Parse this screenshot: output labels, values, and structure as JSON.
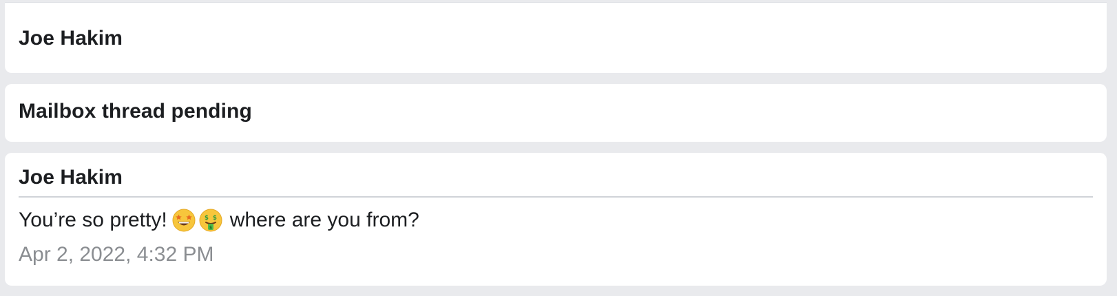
{
  "colors": {
    "background": "#e9eaed",
    "card": "#ffffff",
    "text": "#1c1e21",
    "muted": "#8a8d91",
    "divider": "#d0d3d8"
  },
  "cards": [
    {
      "title": "Joe Hakim"
    },
    {
      "title": "Mailbox thread pending"
    },
    {
      "sender": "Joe Hakim",
      "message_start": "You’re so pretty!",
      "emojis": [
        "star-struck-emoji",
        "money-mouth-emoji"
      ],
      "message_end": "where are you from?",
      "timestamp": "Apr 2, 2022, 4:32 PM"
    }
  ]
}
